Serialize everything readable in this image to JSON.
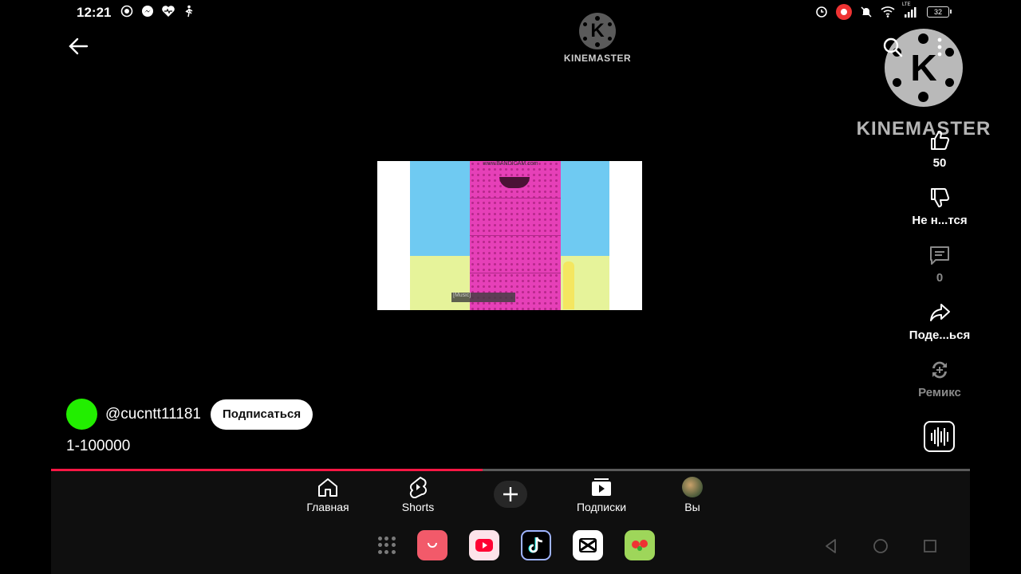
{
  "status_bar": {
    "time": "12:21",
    "battery": "32",
    "icons_left": [
      "record-icon",
      "messenger-icon",
      "health-icon",
      "walk-icon"
    ],
    "icons_right": [
      "alarm-icon",
      "screen-record-icon",
      "mute-icon",
      "wifi-icon",
      "signal-icon",
      "battery-icon"
    ],
    "network_label": "LTE"
  },
  "watermark": {
    "logo_letter": "K",
    "name": "KINEMASTER"
  },
  "video": {
    "caption": "[Music]",
    "watermark": "www.BANDICAM.com"
  },
  "actions": {
    "like_count": "50",
    "dislike_label": "Не н...тся",
    "comments_count": "0",
    "share_label": "Поде...ься",
    "remix_label": "Ремикс"
  },
  "channel": {
    "handle": "@cucntt11181",
    "subscribe_label": "Подписаться",
    "avatar_color": "#22ee00"
  },
  "video_title": "1-100000",
  "progress": {
    "fraction": 0.47,
    "color": "#ff1744"
  },
  "bottom_nav": {
    "home": "Главная",
    "shorts": "Shorts",
    "subscriptions": "Подписки",
    "you": "Вы"
  },
  "dock_apps": [
    "app-icon-pink",
    "youtube-app-icon",
    "tiktok-app-icon",
    "capcut-app-icon",
    "game-app-icon"
  ],
  "colors": {
    "background": "#000000",
    "accent": "#ff1744",
    "nav_background": "#0f0f0f"
  }
}
